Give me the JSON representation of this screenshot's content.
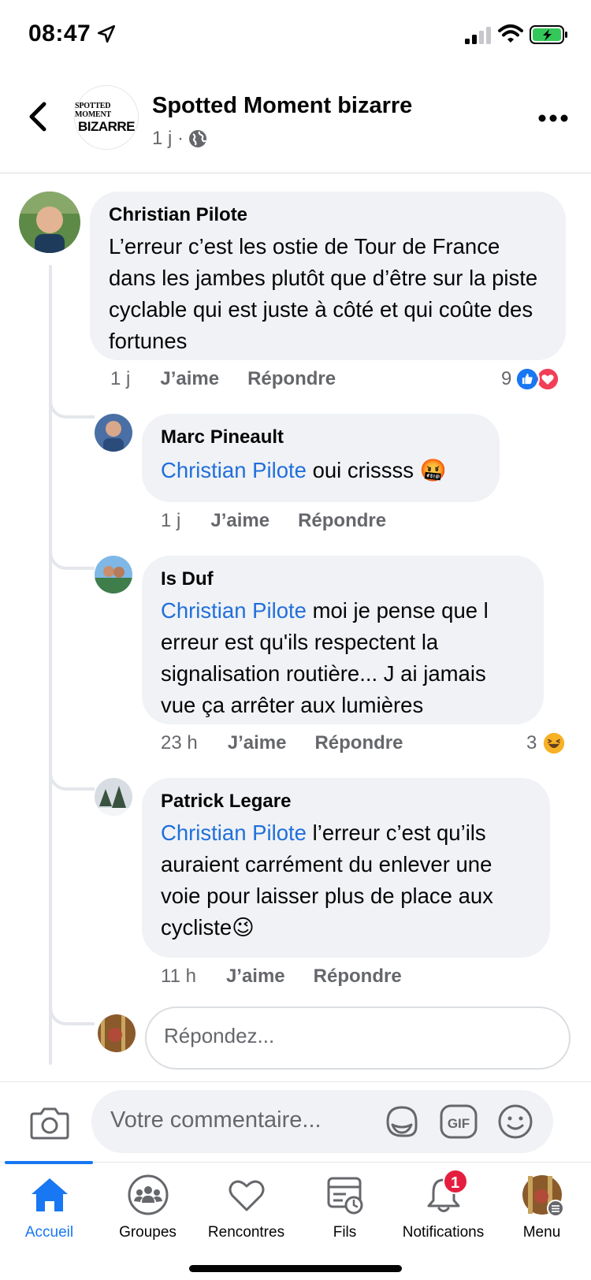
{
  "status_bar": {
    "time": "08:47"
  },
  "header": {
    "logo_top": "SPOTTED MOMENT",
    "logo_bottom": "BIZARRE",
    "group_name": "Spotted Moment bizarre",
    "post_age": "1 j ·"
  },
  "comments": [
    {
      "author": "Christian Pilote",
      "text": "L’erreur c’est les ostie de Tour de France dans les jambes plutôt que d’être sur la piste cyclable qui est juste à côté et qui coûte des fortunes",
      "time": "1 j",
      "like_label": "J’aime",
      "reply_label": "Répondre",
      "reaction_count": "9",
      "reactions": [
        "like-icon",
        "love-icon"
      ]
    },
    {
      "author": "Marc Pineault",
      "mention": "Christian Pilote",
      "text": " oui crissss ",
      "emoji": "🤬",
      "time": "1 j",
      "like_label": "J’aime",
      "reply_label": "Répondre"
    },
    {
      "author": "Is Duf",
      "mention": "Christian Pilote",
      "text": " moi je pense que l erreur est qu'ils respectent la signalisation routière... J ai jamais vue ça arrêter aux lumières",
      "time": "23 h",
      "like_label": "J’aime",
      "reply_label": "Répondre",
      "reaction_count": "3",
      "reactions": [
        "haha-icon"
      ]
    },
    {
      "author": "Patrick Legare",
      "mention": "Christian Pilote",
      "text": " l’erreur c’est qu’ils auraient carrément du enlever une voie pour laisser plus de place aux cycliste",
      "emoji": "😉",
      "time": "11 h",
      "like_label": "J’aime",
      "reply_label": "Répondre"
    }
  ],
  "reply_box": {
    "placeholder": "Répondez..."
  },
  "composer": {
    "placeholder": "Votre commentaire...",
    "gif_label": "GIF"
  },
  "tabbar": {
    "tabs": [
      {
        "label": "Accueil",
        "icon": "home-icon",
        "active": true
      },
      {
        "label": "Groupes",
        "icon": "groups-icon"
      },
      {
        "label": "Rencontres",
        "icon": "heart-icon"
      },
      {
        "label": "Fils",
        "icon": "feeds-icon"
      },
      {
        "label": "Notifications",
        "icon": "bell-icon",
        "badge": "1"
      },
      {
        "label": "Menu",
        "icon": "profile-avatar"
      }
    ]
  },
  "colors": {
    "accent": "#1877f2",
    "mention": "#216fdb",
    "bubble": "#f0f2f5",
    "badge": "#e41e3f"
  }
}
